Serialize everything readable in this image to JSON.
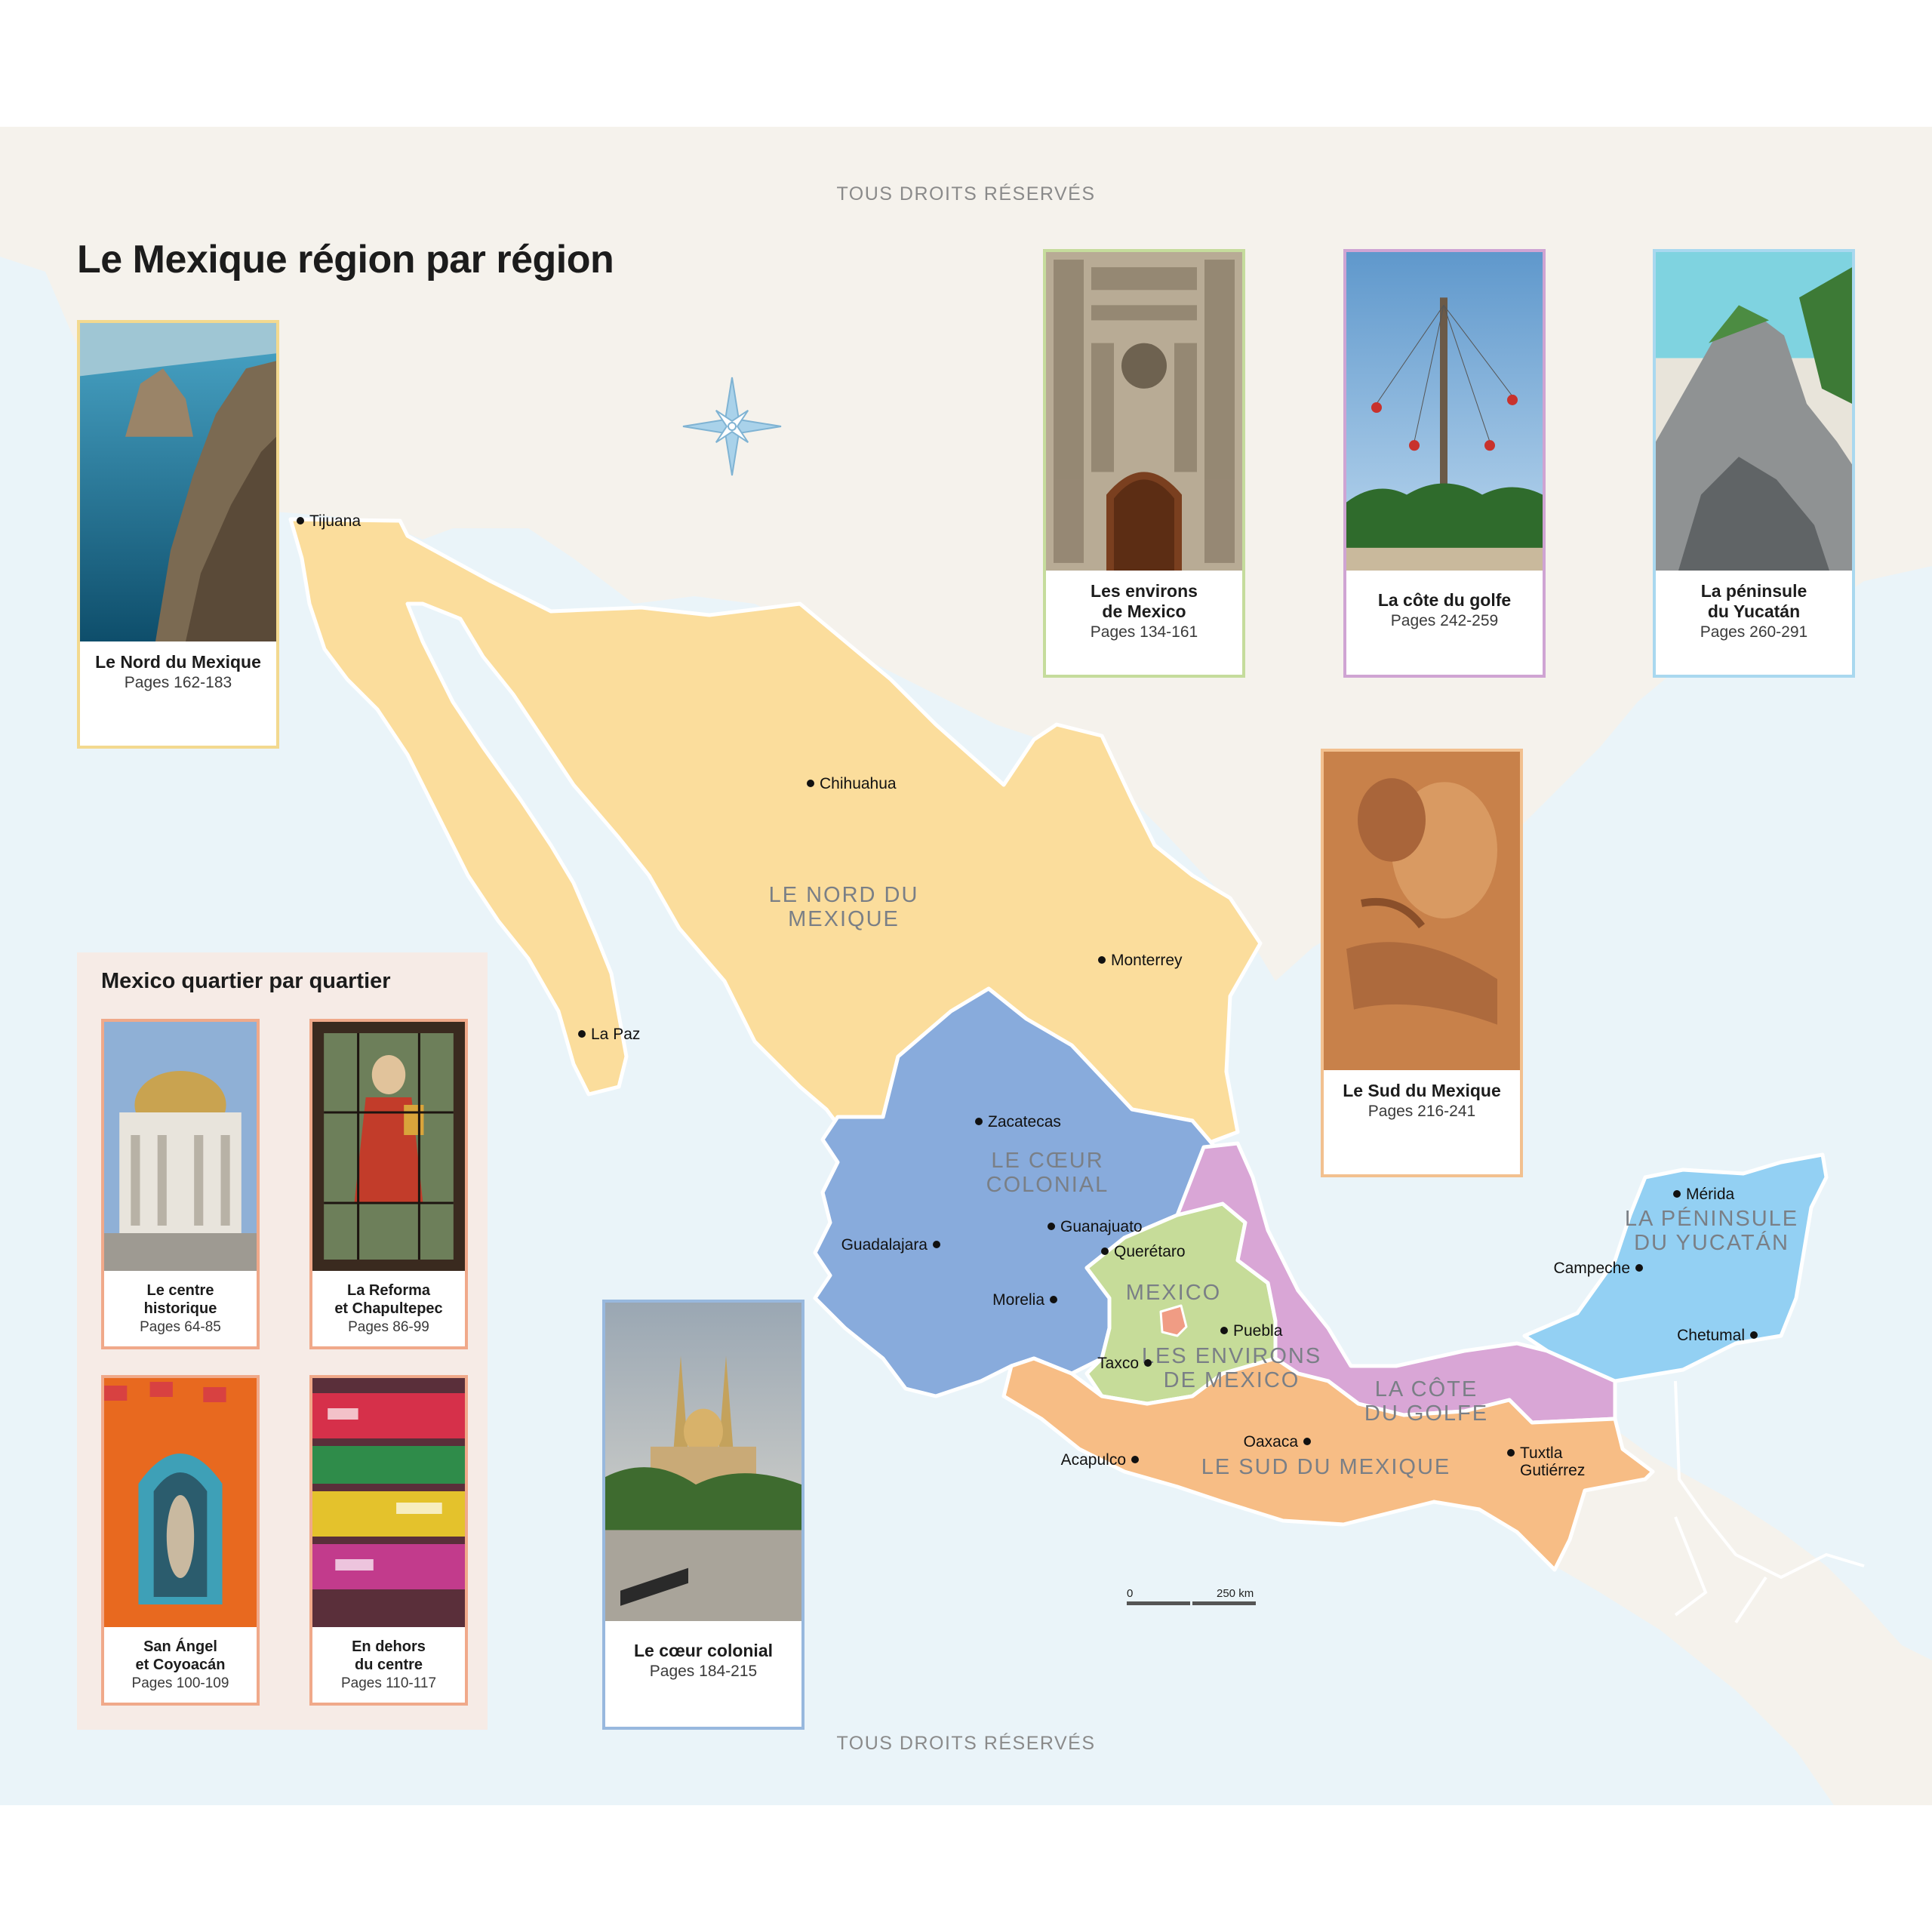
{
  "title": "Le Mexique région par région",
  "rights_notice_top": "TOUS DROITS RÉSERVÉS",
  "rights_notice_bottom": "TOUS DROITS RÉSERVÉS",
  "colors": {
    "sea": "#eaf4f9",
    "neighbour_land": "#f5f2ec",
    "nord": "#fbdd9c",
    "coeur": "#88abdc",
    "environs": "#c6dc99",
    "mexico_city": "#f09c84",
    "golfe": "#d9a6d6",
    "sud": "#f7bd85",
    "yucatan": "#93d0f3"
  },
  "regions": [
    {
      "id": "nord",
      "label": "LE NORD DU\nMEXIQUE"
    },
    {
      "id": "coeur",
      "label": "LE CŒUR\nCOLONIAL"
    },
    {
      "id": "mexico",
      "label": "MEXICO"
    },
    {
      "id": "environs",
      "label": "LES ENVIRONS\nDE MEXICO"
    },
    {
      "id": "golfe",
      "label": "LA CÔTE\nDU GOLFE"
    },
    {
      "id": "sud",
      "label": "LE SUD DU MEXIQUE"
    },
    {
      "id": "yucatan",
      "label": "LA PÉNINSULE\nDU YUCATÁN"
    }
  ],
  "cities": [
    "Tijuana",
    "Chihuahua",
    "Monterrey",
    "La Paz",
    "Zacatecas",
    "Guanajuato",
    "Querétaro",
    "Guadalajara",
    "Morelia",
    "Puebla",
    "Taxco",
    "Oaxaca",
    "Acapulco",
    "Tuxtla\nGutiérrez",
    "Mérida",
    "Campeche",
    "Chetumal"
  ],
  "scale_bar": {
    "start": "0",
    "end": "250 km"
  },
  "region_cards": [
    {
      "id": "nord",
      "name": "Le Nord du Mexique",
      "pages": "Pages 162-183",
      "border": "#f3d98f",
      "image": "sea-cliffs"
    },
    {
      "id": "environs",
      "name": "Les environs\nde Mexico",
      "pages": "Pages 134-161",
      "border": "#c5dc9c",
      "image": "baroque-facade"
    },
    {
      "id": "golfe",
      "name": "La côte du golfe",
      "pages": "Pages 242-259",
      "border": "#cfa4d3",
      "image": "voladores-pole"
    },
    {
      "id": "yucatan",
      "name": "La péninsule\ndu Yucatán",
      "pages": "Pages 260-291",
      "border": "#a9d8ef",
      "image": "coastal-rocks"
    },
    {
      "id": "sud",
      "name": "Le Sud du Mexique",
      "pages": "Pages 216-241",
      "border": "#f2c08f",
      "image": "stone-relief"
    },
    {
      "id": "coeur",
      "name": "Le cœur colonial",
      "pages": "Pages 184-215",
      "border": "#98b8de",
      "image": "cathedral-plaza"
    }
  ],
  "inset": {
    "title": "Mexico quartier par quartier",
    "cards": [
      {
        "name": "Le centre\nhistorique",
        "pages": "Pages 64-85",
        "image": "palace-dome"
      },
      {
        "name": "La Reforma\net Chapultepec",
        "pages": "Pages 86-99",
        "image": "stained-glass"
      },
      {
        "name": "San Ángel\net Coyoacán",
        "pages": "Pages 100-109",
        "image": "niche-shrine"
      },
      {
        "name": "En dehors\ndu centre",
        "pages": "Pages 110-117",
        "image": "painted-boats"
      }
    ],
    "card_border": "#f0a98a"
  }
}
